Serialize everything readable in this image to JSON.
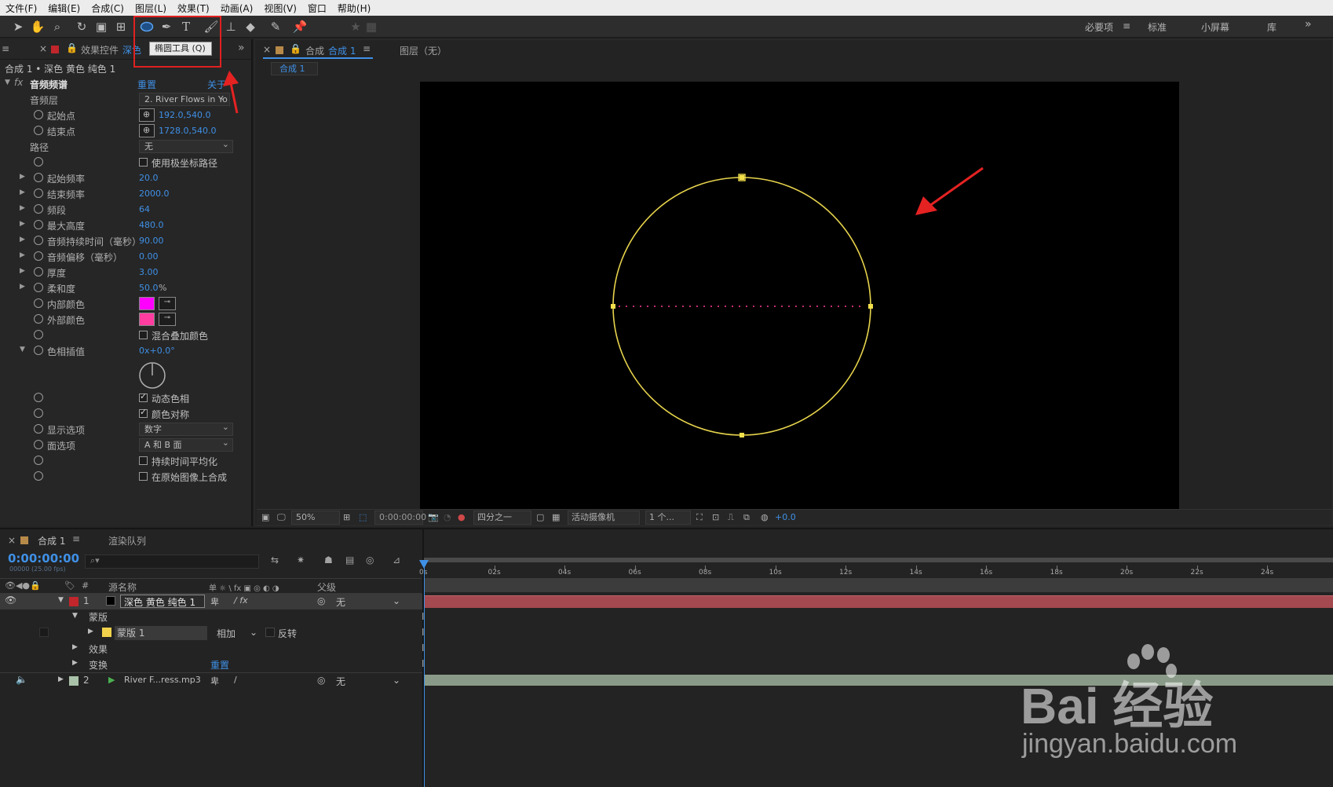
{
  "menu": [
    "文件(F)",
    "编辑(E)",
    "合成(C)",
    "图层(L)",
    "效果(T)",
    "动画(A)",
    "视图(V)",
    "窗口",
    "帮助(H)"
  ],
  "toolbar": {
    "tooltip": "椭圆工具 (Q)",
    "workspaces": [
      "必要项",
      "标准",
      "小屏幕",
      "库"
    ],
    "workspace_menu_icon": "≡"
  },
  "effects_panel": {
    "tab_label": "效果控件",
    "tab_layer": "深色",
    "breadcrumb": "合成 1 • 深色 黄色 纯色 1",
    "effect_name": "音频频谱",
    "reset": "重置",
    "about": "关于",
    "audio_layer_label": "音频层",
    "audio_layer_value": "2. River Flows in Yo",
    "start_point_label": "起始点",
    "start_point_value": "192.0,540.0",
    "end_point_label": "结束点",
    "end_point_value": "1728.0,540.0",
    "path_label": "路径",
    "path_value": "无",
    "polar_path_label": "使用极坐标路径",
    "start_freq_label": "起始频率",
    "start_freq_value": "20.0",
    "end_freq_label": "结束频率",
    "end_freq_value": "2000.0",
    "bands_label": "频段",
    "bands_value": "64",
    "max_height_label": "最大高度",
    "max_height_value": "480.0",
    "duration_label": "音频持续时间（毫秒）",
    "duration_value": "90.00",
    "offset_label": "音频偏移（毫秒）",
    "offset_value": "0.00",
    "thickness_label": "厚度",
    "thickness_value": "3.00",
    "softness_label": "柔和度",
    "softness_value": "50.0",
    "softness_unit": "%",
    "inside_color_label": "内部颜色",
    "inside_color": "#ff00ff",
    "outside_color_label": "外部颜色",
    "outside_color": "#ff3ca0",
    "blend_label": "混合叠加颜色",
    "hue_interp_label": "色相插值",
    "hue_interp_value": "0x+0.0°",
    "dynamic_hue_label": "动态色相",
    "color_sym_label": "颜色对称",
    "display_opt_label": "显示选项",
    "display_opt_value": "数字",
    "side_opt_label": "面选项",
    "side_opt_value": "A 和 B 面",
    "avg_label": "持续时间平均化",
    "composite_label": "在原始图像上合成"
  },
  "comp_panel": {
    "tab_label": "合成",
    "tab_name": "合成 1",
    "layer_label": "图层（无）",
    "sub_tab": "合成 1"
  },
  "viewer_bar": {
    "zoom": "50%",
    "timecode": "0:00:00:00",
    "resolution": "四分之一",
    "camera": "活动摄像机",
    "views": "1 个...",
    "exposure": "+0.0"
  },
  "timeline": {
    "tab_label": "合成 1",
    "render_queue": "渲染队列",
    "timecode": "0:00:00:00",
    "fps": "00000 (25.00 fps)",
    "search_placeholder": "",
    "col_source": "源名称",
    "col_switches": "单 ☼ \\ fx ▣ ◎ ◐ ◑",
    "col_parent": "父级",
    "ticks": [
      "0s",
      "02s",
      "04s",
      "06s",
      "08s",
      "10s",
      "12s",
      "14s",
      "16s",
      "18s",
      "20s",
      "22s",
      "24s"
    ],
    "layer1_num": "1",
    "layer1_name": "深色 黄色 纯色 1",
    "layer1_parent": "无",
    "masks_label": "蒙版",
    "mask1_name": "蒙版 1",
    "mask_mode": "相加",
    "mask_invert": "反转",
    "effects_label": "效果",
    "transform_label": "变换",
    "transform_reset": "重置",
    "layer2_num": "2",
    "layer2_name": "River F...ress.mp3",
    "layer2_parent": "无"
  },
  "watermark": {
    "brand": "Bai 经验",
    "url": "jingyan.baidu.com"
  }
}
